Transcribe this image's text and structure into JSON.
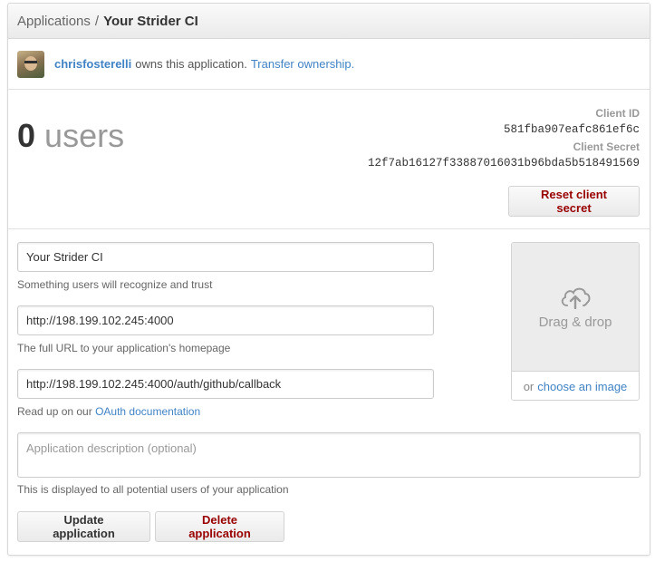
{
  "breadcrumb": {
    "parent": "Applications",
    "separator": "/",
    "current": "Your Strider CI"
  },
  "owner": {
    "username": "chrisfosterelli",
    "text": "owns this application.",
    "transfer_link": "Transfer ownership."
  },
  "stats": {
    "user_count": "0",
    "user_label": "users"
  },
  "credentials": {
    "client_id_label": "Client ID",
    "client_id": "581fba907eafc861ef6c",
    "client_secret_label": "Client Secret",
    "client_secret": "12f7ab16127f33887016031b96bda5b518491569",
    "reset_button": "Reset client secret"
  },
  "form": {
    "name_value": "Your Strider CI",
    "name_hint": "Something users will recognize and trust",
    "homepage_value": "http://198.199.102.245:4000",
    "homepage_hint": "The full URL to your application's homepage",
    "callback_value": "http://198.199.102.245:4000/auth/github/callback",
    "callback_hint_prefix": "Read up on our",
    "callback_hint_link": "OAuth documentation",
    "description_placeholder": "Application description (optional)",
    "description_hint": "This is displayed to all potential users of your application",
    "update_button": "Update application",
    "delete_button": "Delete application"
  },
  "logo_upload": {
    "icon": "cloud-upload-icon",
    "drop_label": "Drag & drop",
    "or_text": "or",
    "choose_link": "choose an image"
  },
  "colors": {
    "link": "#4183c4",
    "danger": "#990000",
    "muted": "#999999"
  }
}
